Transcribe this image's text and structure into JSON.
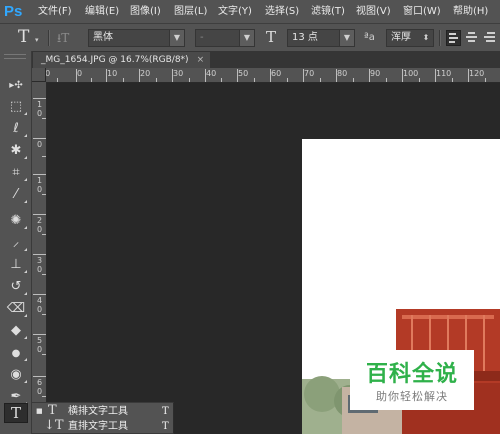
{
  "app": {
    "logo": "Ps"
  },
  "menu": [
    "文件(F)",
    "编辑(E)",
    "图像(I)",
    "图层(L)",
    "文字(Y)",
    "选择(S)",
    "滤镜(T)",
    "视图(V)",
    "窗口(W)",
    "帮助(H)"
  ],
  "options": {
    "tool_glyph": "T",
    "orient_glyph": "⭳T",
    "font_family": "黑体",
    "font_style": "-",
    "size_glyph": "T",
    "font_size": "13 点",
    "aa_glyph": "ªa",
    "antialias": "浑厚"
  },
  "document": {
    "tab_title": "_MG_1654.JPG @ 16.7%(RGB/8*)",
    "close": "×"
  },
  "ruler": {
    "top_labels": [
      "10",
      "0",
      "10",
      "20",
      "30",
      "40",
      "50",
      "60",
      "70",
      "80",
      "90",
      "100",
      "110",
      "120"
    ],
    "left_labels": [
      [
        "1",
        "0"
      ],
      [
        "0"
      ],
      [
        "1",
        "0"
      ],
      [
        "2",
        "0"
      ],
      [
        "3",
        "0"
      ],
      [
        "4",
        "0"
      ],
      [
        "5",
        "0"
      ],
      [
        "6",
        "0"
      ]
    ]
  },
  "toolbar": {
    "tools": [
      {
        "name": "move-tool",
        "icon": "move-icon",
        "glyph": "▸✣"
      },
      {
        "name": "marquee-tool",
        "icon": "marquee-icon",
        "glyph": "⬚"
      },
      {
        "name": "lasso-tool",
        "icon": "lasso-icon",
        "glyph": "ℓ"
      },
      {
        "name": "magic-wand-tool",
        "icon": "magic-wand-icon",
        "glyph": "✱"
      },
      {
        "name": "crop-tool",
        "icon": "crop-icon",
        "glyph": "⌗"
      },
      {
        "name": "eyedropper-tool",
        "icon": "eyedropper-icon",
        "glyph": "⁄"
      },
      {
        "name": "healing-brush-tool",
        "icon": "healing-icon",
        "glyph": "✺"
      },
      {
        "name": "brush-tool",
        "icon": "brush-icon",
        "glyph": "⸝"
      },
      {
        "name": "clone-stamp-tool",
        "icon": "stamp-icon",
        "glyph": "⊥"
      },
      {
        "name": "history-brush-tool",
        "icon": "history-brush-icon",
        "glyph": "↺"
      },
      {
        "name": "eraser-tool",
        "icon": "eraser-icon",
        "glyph": "⌫"
      },
      {
        "name": "paint-bucket-tool",
        "icon": "paint-bucket-icon",
        "glyph": "◆"
      },
      {
        "name": "blur-tool",
        "icon": "blur-icon",
        "glyph": "●"
      },
      {
        "name": "dodge-tool",
        "icon": "dodge-icon",
        "glyph": "◉"
      },
      {
        "name": "pen-tool",
        "icon": "pen-icon",
        "glyph": "✒"
      },
      {
        "name": "type-tool",
        "icon": "type-icon",
        "glyph": "T"
      }
    ]
  },
  "flyout": {
    "items": [
      {
        "bullet": "■",
        "glyph": "T",
        "label": "横排文字工具",
        "key": "T"
      },
      {
        "bullet": "",
        "glyph": "↓T",
        "label": "直排文字工具",
        "key": "T"
      }
    ]
  },
  "watermark": {
    "title": "百科全说",
    "subtitle": "助你轻松解决"
  }
}
